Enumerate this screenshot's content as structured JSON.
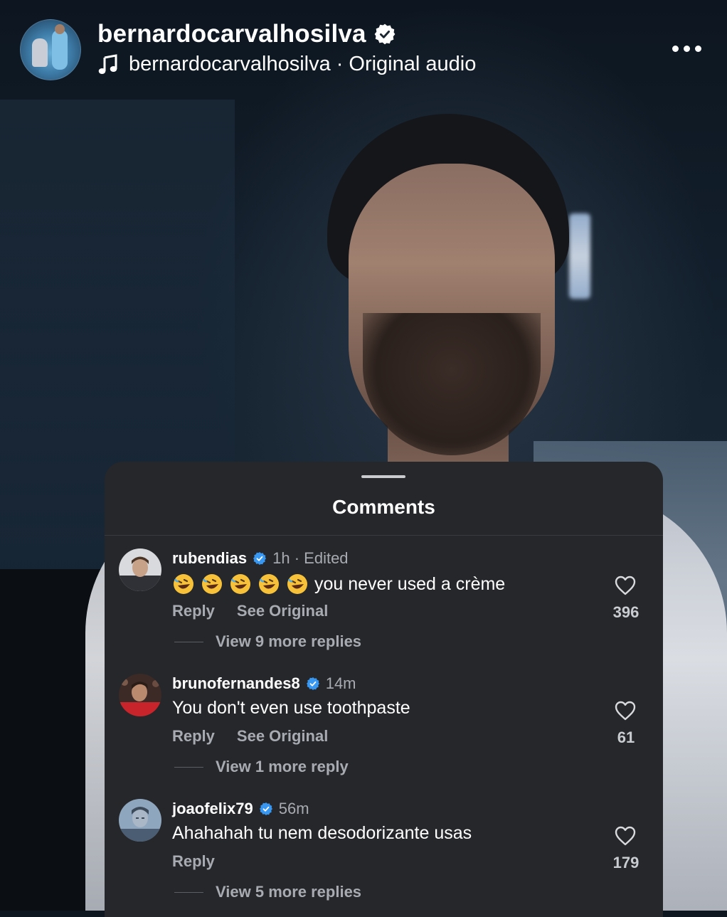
{
  "header": {
    "username": "bernardocarvalhosilva",
    "audio_artist": "bernardocarvalhosilva",
    "audio_separator": "·",
    "audio_label": "Original audio",
    "icons": [
      "verified-badge-icon",
      "music-note-icon",
      "more-icon"
    ]
  },
  "sheet": {
    "title": "Comments"
  },
  "comments": [
    {
      "user": "rubendias",
      "verified": true,
      "time": "1h · Edited",
      "text": "you never used a crème",
      "emoji_prefix": [
        "🤣",
        "🤣",
        "🤣",
        "🤣",
        "🤣"
      ],
      "reply_label": "Reply",
      "see_original_label": "See Original",
      "likes": "396",
      "view_replies": "View 9 more replies"
    },
    {
      "user": "brunofernandes8",
      "verified": true,
      "time": "14m",
      "text": "You don't even use toothpaste",
      "reply_label": "Reply",
      "see_original_label": "See Original",
      "likes": "61",
      "view_replies": "View 1 more reply"
    },
    {
      "user": "joaofelix79",
      "verified": true,
      "time": "56m",
      "text": "Ahahahah tu nem desodorizante usas",
      "reply_label": "Reply",
      "likes": "179",
      "view_replies": "View 5 more replies"
    }
  ],
  "colors": {
    "sheet_bg": "#26272b",
    "verified_blue": "#3897f0",
    "secondary_text": "#a8abb1"
  }
}
